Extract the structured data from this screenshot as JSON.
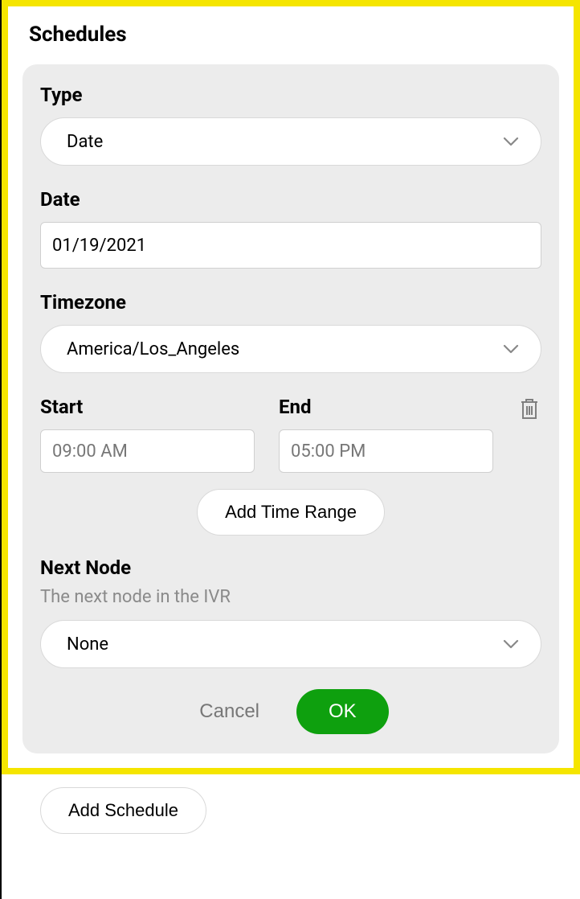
{
  "title": "Schedules",
  "type": {
    "label": "Type",
    "value": "Date"
  },
  "date": {
    "label": "Date",
    "value": "01/19/2021"
  },
  "timezone": {
    "label": "Timezone",
    "value": "America/Los_Angeles"
  },
  "timeRange": {
    "startLabel": "Start",
    "startValue": "09:00 AM",
    "endLabel": "End",
    "endValue": "05:00 PM"
  },
  "addTimeRange": "Add Time Range",
  "nextNode": {
    "label": "Next Node",
    "helper": "The next node in the IVR",
    "value": "None"
  },
  "actions": {
    "cancel": "Cancel",
    "ok": "OK"
  },
  "addSchedule": "Add Schedule"
}
